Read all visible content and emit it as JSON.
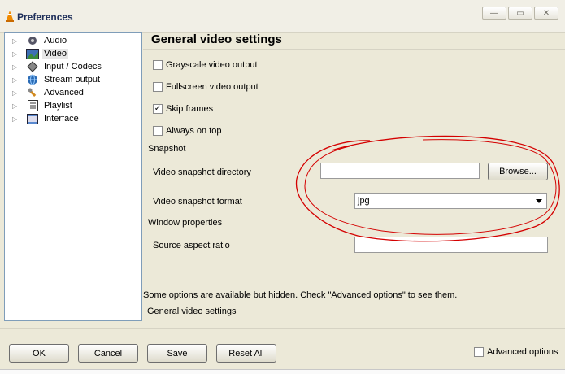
{
  "window": {
    "title": "Preferences"
  },
  "tree": {
    "items": [
      {
        "label": "Audio",
        "icon": "audio-icon"
      },
      {
        "label": "Video",
        "icon": "video-icon",
        "selected": true
      },
      {
        "label": "Input / Codecs",
        "icon": "input-codecs-icon"
      },
      {
        "label": "Stream output",
        "icon": "stream-output-icon"
      },
      {
        "label": "Advanced",
        "icon": "advanced-icon"
      },
      {
        "label": "Playlist",
        "icon": "playlist-icon"
      },
      {
        "label": "Interface",
        "icon": "interface-icon"
      }
    ]
  },
  "panel": {
    "title": "General video settings",
    "checkboxes": [
      {
        "label": "Grayscale video output",
        "checked": false
      },
      {
        "label": "Fullscreen video output",
        "checked": false
      },
      {
        "label": "Skip frames",
        "checked": true
      },
      {
        "label": "Always on top",
        "checked": false
      }
    ],
    "snapshot": {
      "section": "Snapshot",
      "dir_label": "Video snapshot directory",
      "dir_value": "",
      "browse_label": "Browse...",
      "format_label": "Video snapshot format",
      "format_value": "jpg"
    },
    "window_props": {
      "section": "Window properties",
      "aspect_label": "Source aspect ratio",
      "aspect_value": ""
    },
    "hint": "Some options are available but hidden. Check \"Advanced options\" to see them.",
    "footer_section": "General video settings"
  },
  "buttons": {
    "ok": "OK",
    "cancel": "Cancel",
    "save": "Save",
    "reset": "Reset All"
  },
  "advanced_options": {
    "label": "Advanced options",
    "checked": false
  },
  "colors": {
    "annotation": "#d40000",
    "title": "#1f2f5a"
  }
}
